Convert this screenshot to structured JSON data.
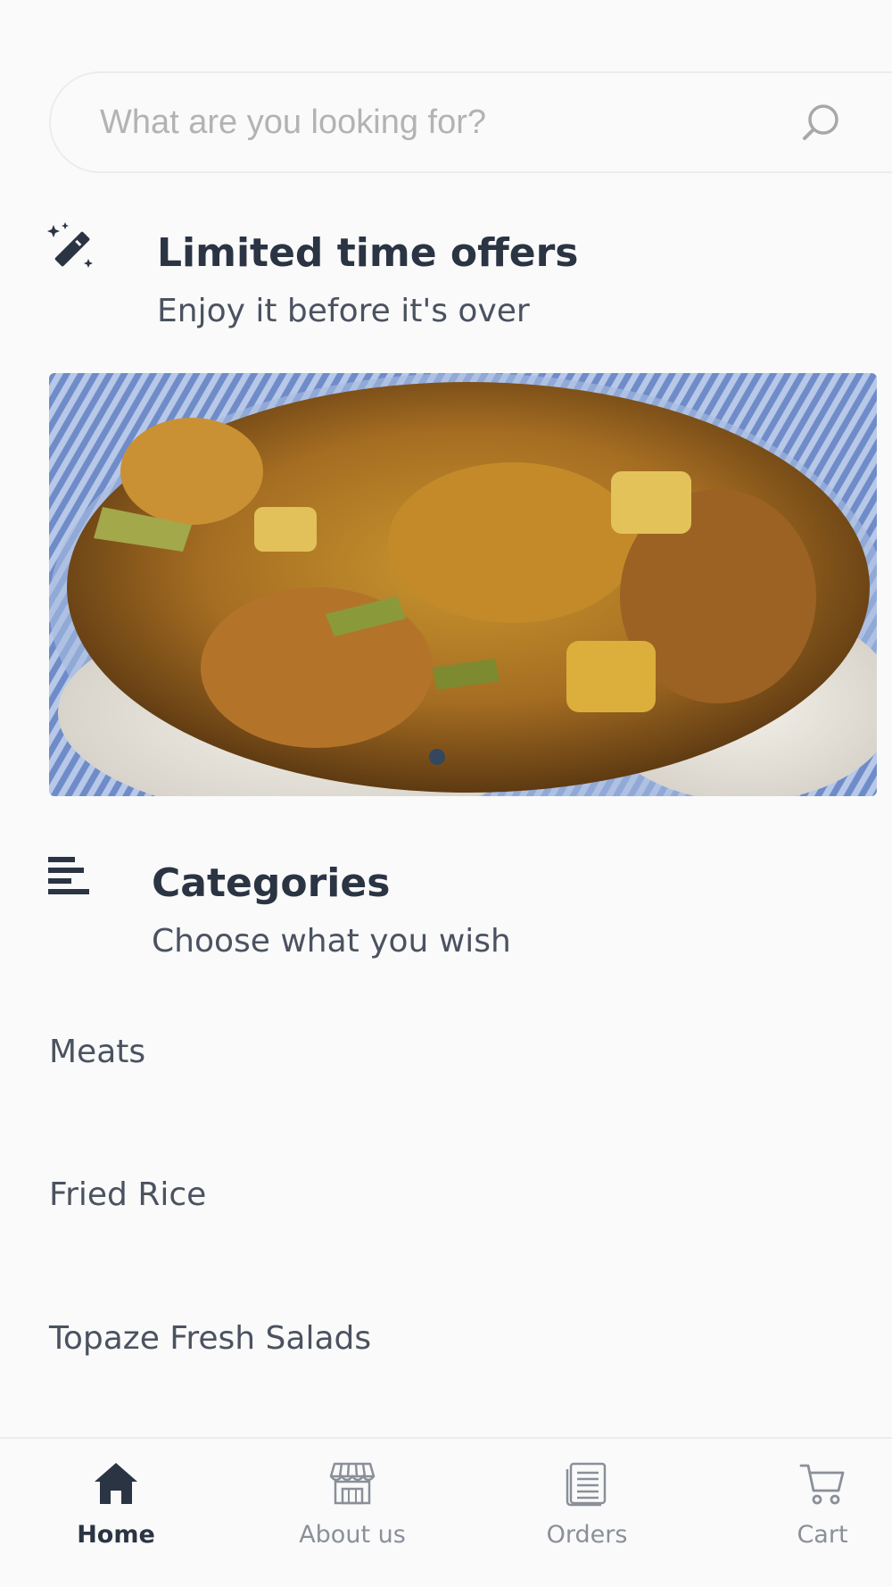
{
  "search": {
    "placeholder": "What are you looking for?",
    "value": ""
  },
  "offers": {
    "title": "Limited time offers",
    "subtitle": "Enjoy it before it's over",
    "icon": "magic-wand-icon",
    "banner_image": "rice-and-curry-dish",
    "carousel_active_index": 0
  },
  "categories": {
    "title": "Categories",
    "subtitle": "Choose what you wish",
    "icon": "menu-lines-icon",
    "items": [
      {
        "label": "Meats"
      },
      {
        "label": "Fried Rice"
      },
      {
        "label": "Topaze Fresh Salads"
      }
    ]
  },
  "bottom_nav": {
    "items": [
      {
        "label": "Home",
        "icon": "home-icon",
        "active": true
      },
      {
        "label": "About us",
        "icon": "store-icon",
        "active": false
      },
      {
        "label": "Orders",
        "icon": "orders-icon",
        "active": false
      },
      {
        "label": "Cart",
        "icon": "cart-icon",
        "active": false
      }
    ]
  },
  "colors": {
    "background": "#fafafa",
    "heading": "#2b3443",
    "text": "#4b5260",
    "placeholder": "#b3b3b3",
    "inactive_nav": "#8a8f99",
    "border": "#ececec"
  }
}
